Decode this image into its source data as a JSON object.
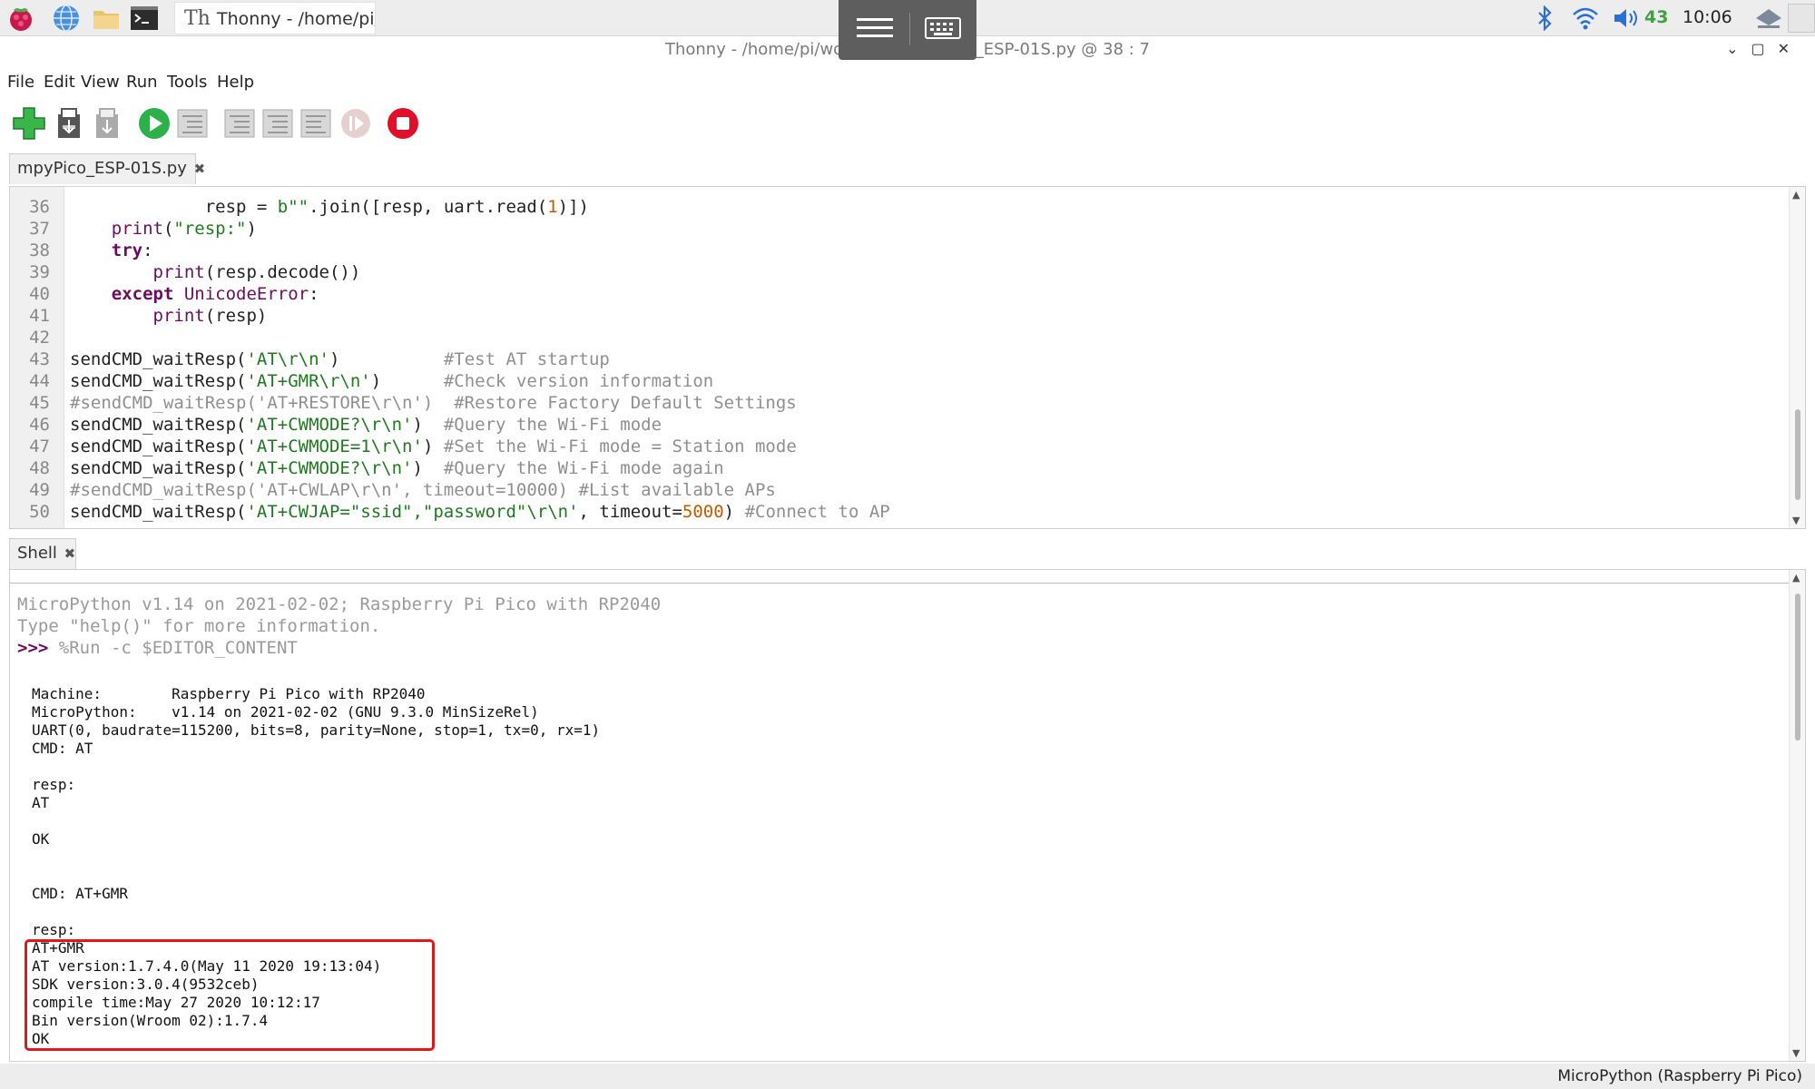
{
  "taskbar": {
    "task_title": "Thonny  -  /home/pi/...",
    "volume_level": "43",
    "clock": "10:06"
  },
  "window": {
    "title": "Thonny  -  /home/pi/worksPico/mpyPico_ESP-01S.py  @  38 : 7",
    "controls": "⌄▢✕"
  },
  "menu": [
    "File",
    "Edit",
    "View",
    "Run",
    "Tools",
    "Help"
  ],
  "toolbar_icons": [
    "new-file",
    "open-file",
    "save-file",
    "run",
    "debug",
    "step-over",
    "step-into",
    "step-out",
    "resume",
    "stop"
  ],
  "editor": {
    "tab_label": "mpyPico_ESP-01S.py",
    "tab_close": "✖"
  },
  "shell": {
    "tab_label": "Shell",
    "tab_close": "✖",
    "banner1": "MicroPython v1.14 on 2021-02-02; Raspberry Pi Pico with RP2040",
    "banner2": "Type \"help()\" for more information.",
    "prompt": ">>>",
    "command": " %Run -c $EDITOR_CONTENT",
    "output": [
      "Machine:        Raspberry Pi Pico with RP2040",
      "MicroPython:    v1.14 on 2021-02-02 (GNU 9.3.0 MinSizeRel)",
      "UART(0, baudrate=115200, bits=8, parity=None, stop=1, tx=0, rx=1)",
      "CMD: AT",
      "",
      "resp:",
      "AT",
      "",
      "OK",
      "",
      "",
      "CMD: AT+GMR",
      "",
      "resp:",
      "AT+GMR",
      "AT version:1.7.4.0(May 11 2020 19:13:04)",
      "SDK version:3.0.4(9532ceb)",
      "compile time:May 27 2020 10:12:17",
      "Bin version(Wroom 02):1.7.4",
      "OK"
    ]
  },
  "status": {
    "interpreter": "MicroPython (Raspberry Pi Pico)"
  },
  "colors": {
    "keyword": "#6b0d5e",
    "string": "#1f7a1f",
    "number": "#c25a00",
    "comment": "#8f8f8f",
    "highlight_box": "#e01818",
    "run_green": "#2bb04a",
    "stop_red": "#e0102a"
  }
}
